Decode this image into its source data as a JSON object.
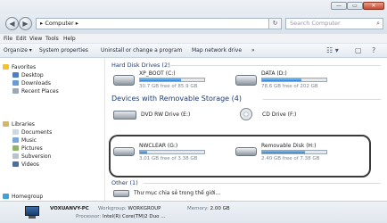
{
  "window": {
    "min_glyph": "—",
    "max_glyph": "▭",
    "close_glyph": "✕"
  },
  "address": {
    "back_glyph": "◀",
    "forward_glyph": "▶",
    "path": "▸ Computer ▸",
    "refresh_glyph": "↻",
    "search_placeholder": "Search Computer",
    "search_glyph": "⌕"
  },
  "menu": [
    "File",
    "Edit",
    "View",
    "Tools",
    "Help"
  ],
  "toolbar": {
    "items": [
      "Organize ▾",
      "System properties",
      "Uninstall or change a program",
      "Map network drive",
      "»"
    ],
    "right_icons": [
      "☷ ▾",
      "▢",
      "?"
    ]
  },
  "navpane": {
    "favorites_label": "Favorites",
    "favorites": [
      "Desktop",
      "Downloads",
      "Recent Places"
    ],
    "libraries_label": "Libraries",
    "libraries": [
      "Documents",
      "Music",
      "Pictures",
      "Subversion",
      "Videos"
    ],
    "more_label": "Homegroup"
  },
  "content": {
    "hdd_header": "Hard Disk Drives (2)",
    "hdd": [
      {
        "name": "XP_BOOT (C:)",
        "free": "30.7 GB free of 85.9 GB",
        "used_fraction": 0.64
      },
      {
        "name": "DATA (D:)",
        "free": "78.6 GB free of 202 GB",
        "used_fraction": 0.61
      }
    ],
    "removable_header": "Devices with Removable Storage (4)",
    "optical": [
      {
        "name": "DVD RW Drive (E:)",
        "icon": "dvd-drive-icon"
      },
      {
        "name": "CD Drive (F:)",
        "icon": "cd-drive-icon"
      }
    ],
    "removable": [
      {
        "name": "NWCLEAR (G:)",
        "free": "3.01 GB free of 3.38 GB",
        "used_fraction": 0.11
      },
      {
        "name": "Removable Disk (H:)",
        "free": "2.40 GB free of 7.38 GB",
        "used_fraction": 0.67
      }
    ],
    "other_header": "Other (1)",
    "other_item": "Thư mục chia sẻ trong thế giới..."
  },
  "details": {
    "computer_name": "VOXUANVY-PC",
    "workgroup_label": "Workgroup:",
    "workgroup": "WORKGROUP",
    "memory_label": "Memory:",
    "memory": "2.00 GB",
    "processor_label": "Processor:",
    "processor": "Intel(R) Core(TM)2 Duo ..."
  },
  "colors": {
    "bar_fill": "#2b83d6",
    "header_text": "#1e3a6e",
    "highlight_border": "#3a3a3a"
  }
}
